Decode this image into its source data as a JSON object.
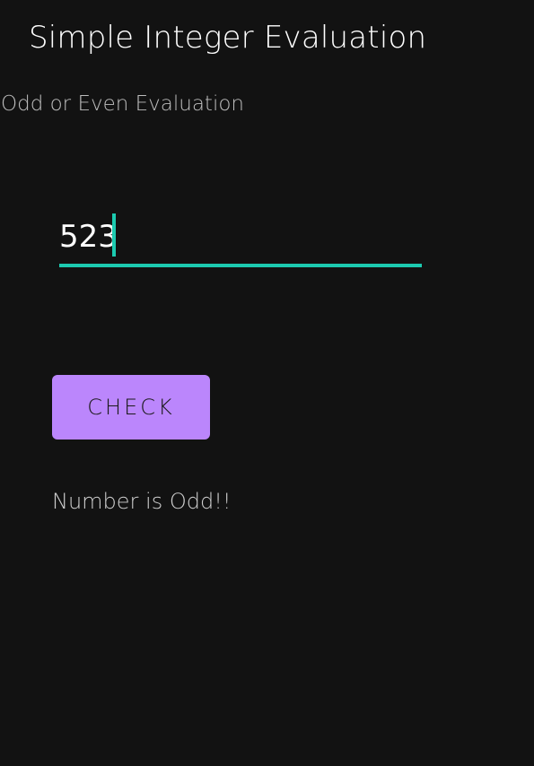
{
  "app": {
    "title": "Simple Integer Evaluation"
  },
  "main": {
    "subtitle": "Odd or Even Evaluation",
    "input": {
      "value": "523",
      "placeholder": ""
    },
    "check_button_label": "CHECK",
    "result": "Number is Odd!!"
  },
  "colors": {
    "background": "#121212",
    "accent": "#1ccab0",
    "button": "#bb86fc"
  }
}
